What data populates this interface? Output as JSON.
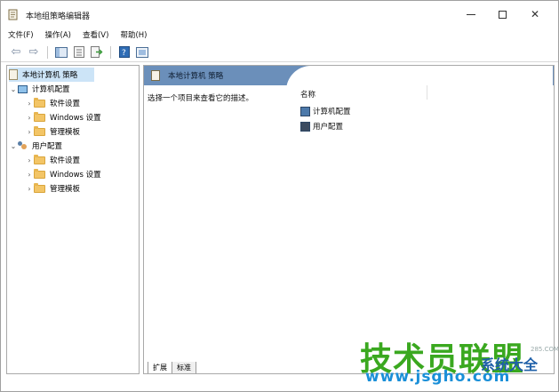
{
  "window": {
    "title": "本地组策略编辑器"
  },
  "menu": [
    "文件(F)",
    "操作(A)",
    "查看(V)",
    "帮助(H)"
  ],
  "tree": {
    "root": "本地计算机 策略",
    "computer_config": {
      "label": "计算机配置",
      "children": [
        "软件设置",
        "Windows 设置",
        "管理模板"
      ]
    },
    "user_config": {
      "label": "用户配置",
      "children": [
        "软件设置",
        "Windows 设置",
        "管理模板"
      ]
    }
  },
  "content": {
    "header": "本地计算机 策略",
    "description": "选择一个项目来查看它的描述。",
    "column_name": "名称",
    "items": [
      "计算机配置",
      "用户配置"
    ]
  },
  "tabs": [
    "扩展",
    "标准"
  ],
  "watermark": {
    "main": "技术员联盟",
    "sub": "系统大全",
    "small": "285.COM",
    "url": "www.jsgho.com"
  },
  "colors": {
    "content_header": "#6b8fba",
    "selected_row": "#cce4f7",
    "watermark_green": "#3aa81f"
  }
}
